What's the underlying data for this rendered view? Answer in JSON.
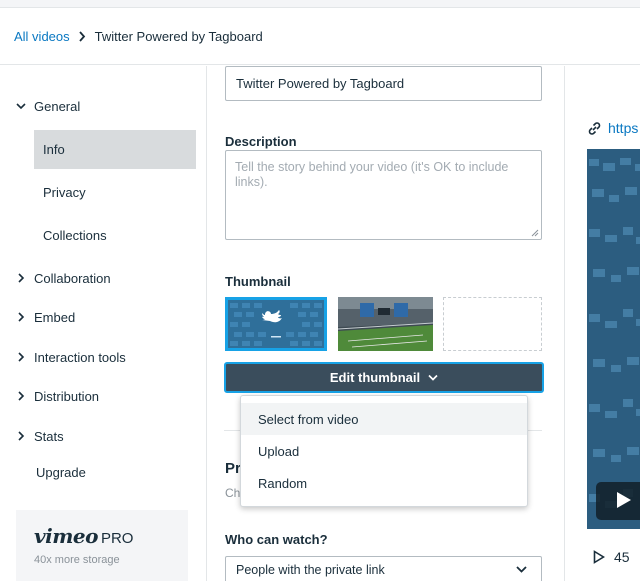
{
  "breadcrumb": {
    "root": "All videos",
    "current": "Twitter Powered by Tagboard"
  },
  "sidebar": {
    "general": "General",
    "sub_items": [
      "Info",
      "Privacy",
      "Collections"
    ],
    "sections": [
      "Collaboration",
      "Embed",
      "Interaction tools",
      "Distribution",
      "Stats"
    ],
    "upgrade": "Upgrade",
    "pro_brand": "vimeo",
    "pro_tier": "PRO",
    "pro_subtitle": "40x more storage"
  },
  "form": {
    "title_value": "Twitter Powered by Tagboard",
    "description_label": "Description",
    "description_placeholder": "Tell the story behind your video (it's OK to include links).",
    "thumbnail_label": "Thumbnail",
    "edit_thumbnail_label": "Edit thumbnail",
    "privacy_heading_partial": "Pr",
    "privacy_sub_partial": "Ch",
    "who_can_watch_label": "Who can watch?",
    "who_can_watch_value": "People with the private link"
  },
  "thumbnail_menu": [
    "Select from video",
    "Upload",
    "Random"
  ],
  "right": {
    "link_text": "https",
    "play_count": "45"
  },
  "colors": {
    "accent": "#0a78c2",
    "focus": "#17a2e6",
    "button": "#3a4d5c",
    "active_nav": "#d8dbdd"
  },
  "icons": {
    "breadcrumb_separator": "chevron-right-icon",
    "menu_toggle": "chevron-down-icon",
    "link": "link-icon",
    "play": "play-icon"
  }
}
